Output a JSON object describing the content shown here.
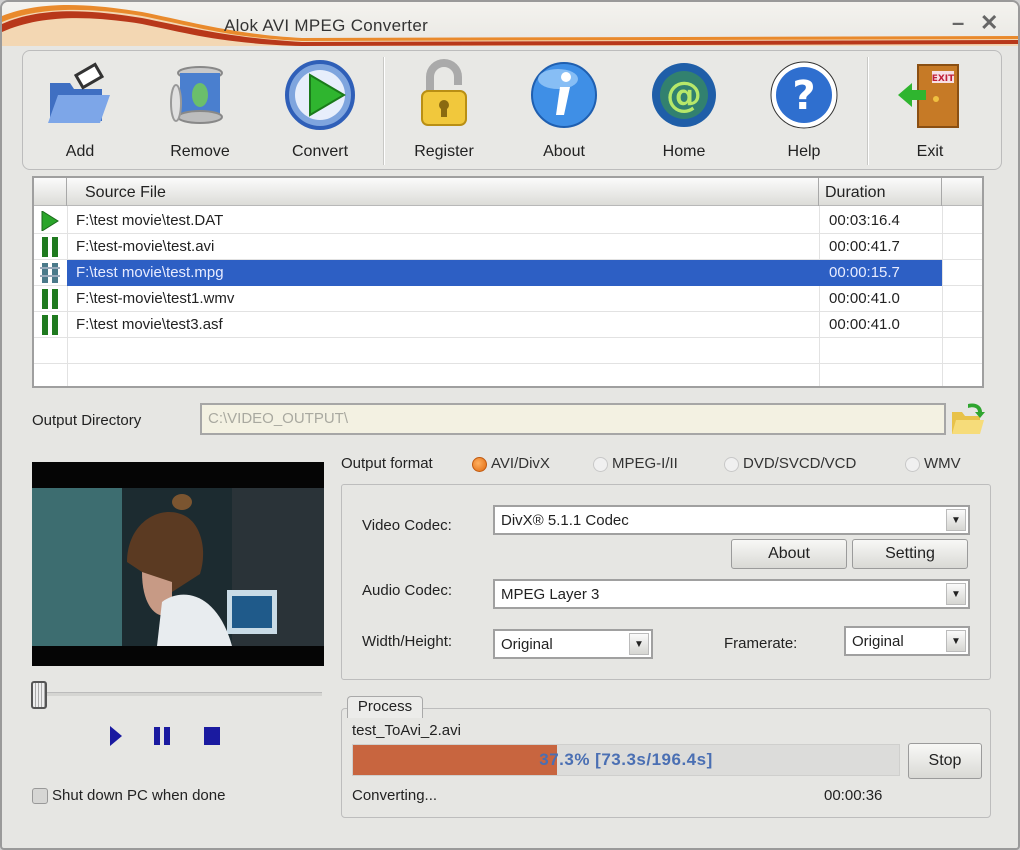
{
  "window": {
    "title": "Alok AVI MPEG Converter",
    "minimize_label": "–",
    "close_label": "✕"
  },
  "toolbar": {
    "buttons": [
      {
        "label": "Add",
        "icon": "open-folder-icon"
      },
      {
        "label": "Remove",
        "icon": "trash-bin-icon"
      },
      {
        "label": "Convert",
        "icon": "play-circle-icon"
      },
      {
        "label": "Register",
        "icon": "padlock-icon"
      },
      {
        "label": "About",
        "icon": "info-icon"
      },
      {
        "label": "Home",
        "icon": "at-globe-icon"
      },
      {
        "label": "Help",
        "icon": "question-icon"
      },
      {
        "label": "Exit",
        "icon": "exit-door-icon"
      }
    ]
  },
  "file_list": {
    "columns": [
      "Source File",
      "Duration"
    ],
    "rows": [
      {
        "status": "playing",
        "file": "F:\\test movie\\test.DAT",
        "duration": "00:03:16.4",
        "selected": false
      },
      {
        "status": "paused",
        "file": "F:\\test-movie\\test.avi",
        "duration": "00:00:41.7",
        "selected": false
      },
      {
        "status": "converting",
        "file": "F:\\test movie\\test.mpg",
        "duration": "00:00:15.7",
        "selected": true
      },
      {
        "status": "paused",
        "file": "F:\\test-movie\\test1.wmv",
        "duration": "00:00:41.0",
        "selected": false
      },
      {
        "status": "paused",
        "file": "F:\\test movie\\test3.asf",
        "duration": "00:00:41.0",
        "selected": false
      }
    ]
  },
  "output": {
    "label": "Output Directory",
    "value": "C:\\VIDEO_OUTPUT\\"
  },
  "player": {
    "seek_position": 0,
    "shutdown_label": "Shut down PC when done",
    "shutdown_checked": false
  },
  "format": {
    "label": "Output format",
    "options": [
      "AVI/DivX",
      "MPEG-I/II",
      "DVD/SVCD/VCD",
      "WMV"
    ],
    "selected": "AVI/DivX"
  },
  "codec": {
    "video_label": "Video Codec:",
    "video_value": "DivX® 5.1.1 Codec",
    "about_label": "About",
    "setting_label": "Setting",
    "audio_label": "Audio Codec:",
    "audio_value": "MPEG Layer 3",
    "size_label": "Width/Height:",
    "size_value": "Original",
    "framerate_label": "Framerate:",
    "framerate_value": "Original"
  },
  "process": {
    "tab_label": "Process",
    "file": "test_ToAvi_2.avi",
    "percent": 37.3,
    "progress_text": "37.3%  [73.3s/196.4s]",
    "stop_label": "Stop",
    "status": "Converting...",
    "elapsed": "00:00:36"
  },
  "colors": {
    "accent_orange": "#c8653f",
    "selection_blue": "#2d5fc4",
    "status_green": "#1f7a1f"
  }
}
